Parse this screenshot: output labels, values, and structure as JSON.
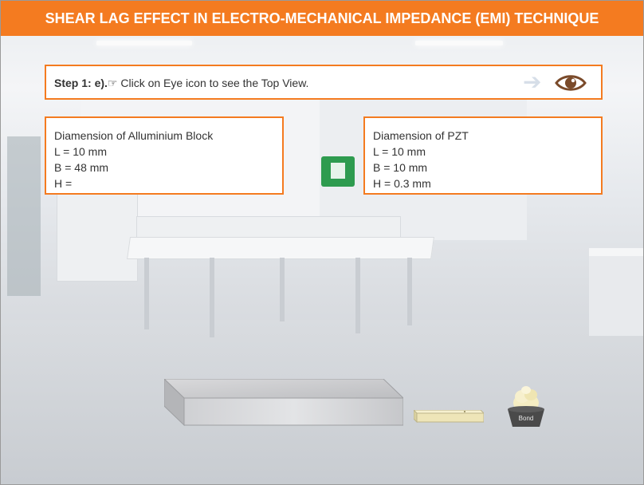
{
  "header": {
    "title": "SHEAR LAG EFFECT IN ELECTRO-MECHANICAL IMPEDANCE (EMI) TECHNIQUE"
  },
  "step": {
    "label": "Step 1: e).",
    "hand_icon": "pointing-hand-icon",
    "text": " Click on Eye icon to see the Top View.",
    "arrow_icon": "right-arrow-icon",
    "eye_icon": "eye-icon"
  },
  "aluminium": {
    "title": "Diamension of Alluminium Block",
    "L": "L = 10 mm",
    "B": "B = 48 mm",
    "H": "H ="
  },
  "pzt": {
    "title": "Diamension of PZT",
    "L": "L = 10 mm",
    "B": "B = 10 mm",
    "H": "H = 0.3 mm"
  },
  "objects": {
    "bond_label": "Bond"
  },
  "colors": {
    "accent": "#f47b20",
    "eye": "#7a4a2a"
  }
}
